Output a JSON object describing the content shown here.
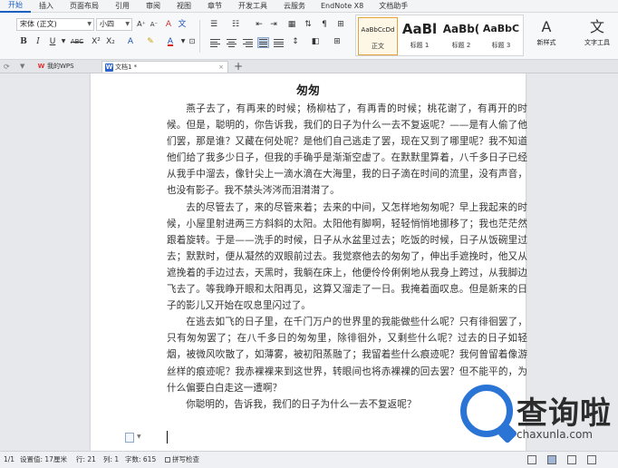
{
  "menu": {
    "tabs": [
      "开始",
      "插入",
      "页面布局",
      "引用",
      "审阅",
      "视图",
      "章节",
      "开发工具",
      "云服务",
      "EndNote X8",
      "文档助手"
    ],
    "active": "开始"
  },
  "ribbon": {
    "font_name": "宋体 (正文)",
    "font_size": "小四",
    "bold_label": "B",
    "italic_label": "I",
    "underline_label": "U",
    "strike_label": "ABC",
    "superscript_label": "X²",
    "subscript_label": "X₂",
    "font_color_label": "A",
    "grow_font_label": "A⁺",
    "shrink_font_label": "A⁻",
    "clear_format_label": "A",
    "styles": [
      {
        "sample": "AaBbCcDd",
        "label": "正文"
      },
      {
        "sample": "AaBl",
        "label": "标题 1"
      },
      {
        "sample": "AaBb(",
        "label": "标题 2"
      },
      {
        "sample": "AaBbC",
        "label": "标题 3"
      }
    ],
    "new_style_label": "新样式",
    "text_tool_label": "文字工具",
    "accent_color": "#1b5fbf"
  },
  "tabstrip": {
    "wps_tab_label": "我的WPS",
    "doc_tab_label": "文档1 *",
    "add_tab_label": "+"
  },
  "document": {
    "title": "匆匆",
    "paragraphs": [
      "燕子去了，有再来的时候；杨柳枯了，有再青的时候；桃花谢了，有再开的时候。但是，聪明的，你告诉我，我们的日子为什么一去不复返呢？——是有人偷了他们罢，那是谁？又藏在何处呢？是他们自己逃走了罢，现在又到了哪里呢？我不知道他们给了我多少日子，但我的手确乎是渐渐空虚了。在默默里算着，八千多日子已经从我手中溜去，像针尖上一滴水滴在大海里，我的日子滴在时间的流里，没有声音，也没有影子。我不禁头涔涔而泪潸潸了。",
      "去的尽管去了，来的尽管来着；去来的中间，又怎样地匆匆呢？早上我起来的时候，小屋里射进两三方斜斜的太阳。太阳他有脚啊，轻轻悄悄地挪移了；我也茫茫然跟着旋转。于是——洗手的时候，日子从水盆里过去；吃饭的时候，日子从饭碗里过去；默默时，便从凝然的双眼前过去。我觉察他去的匆匆了，伸出手遮挽时，他又从遮挽着的手边过去，天黑时，我躺在床上，他便伶伶俐俐地从我身上跨过，从我脚边飞去了。等我睁开眼和太阳再见，这算又溜走了一日。我掩着面叹息。但是新来的日子的影儿又开始在叹息里闪过了。",
      "在逃去如飞的日子里，在千门万户的世界里的我能做些什么呢？只有徘徊罢了，只有匆匆罢了；在八千多日的匆匆里，除徘徊外，又剩些什么呢？过去的日子如轻烟，被微风吹散了，如薄雾，被初阳蒸融了；我留着些什么痕迹呢？我何曾留着像游丝样的痕迹呢？我赤裸裸来到这世界，转眼间也将赤裸裸的回去罢？但不能平的，为什么偏要白白走这一遭啊？",
      "你聪明的，告诉我，我们的日子为什么一去不复返呢？"
    ]
  },
  "watermark": {
    "cn": "查询啦",
    "url": "chaxunla.com"
  },
  "status": {
    "pages": "1/1",
    "setting": "设置值: 17厘米",
    "row": "行: 21",
    "col": "列: 1",
    "words": "字数: 615",
    "spellcheck": "拼写检查"
  }
}
